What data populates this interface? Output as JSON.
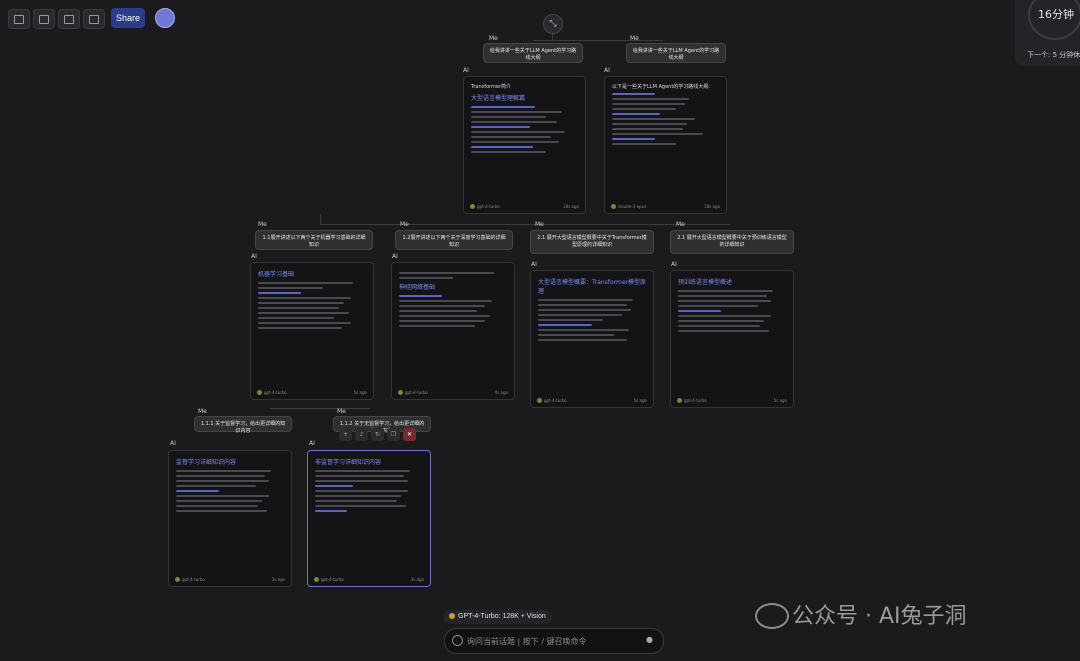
{
  "toolbar": {
    "share_label": "Share"
  },
  "timer": {
    "value": "16分钟",
    "next_label": "下一个: 5 分钟休息"
  },
  "labels": {
    "me": "Me",
    "ai": "AI"
  },
  "nodes": {
    "root_left": {
      "prompt": "给我讲讲一些关于LLM Agent的学习路线大纲",
      "title": "Transformer简介",
      "heading": "大型语言模型理解篇",
      "model": "gpt-4-turbo",
      "time": "18s ago"
    },
    "root_right": {
      "prompt": "给我讲讲一些关于LLM Agent的学习路线大纲",
      "title": "以下是一些关于LLM Agent的学习路线大纲:",
      "model": "claude-3-opus",
      "time": "18s ago"
    },
    "n1": {
      "prompt": "1.1展开讲述以下两个关于机器学习基础的详细知识",
      "heading": "机器学习基础",
      "model": "gpt-4-turbo",
      "time": "5s ago"
    },
    "n2": {
      "prompt": "1.2展开讲述以下两个关于深度学习基础的详细知识",
      "heading": "神经网络基础",
      "model": "gpt-4-turbo",
      "time": "4s ago"
    },
    "n3": {
      "prompt": "2.1 展开大型语言模型概要中关于Transformer模型原理的详细知识",
      "heading": "大型语言模型概要：Transformer模型原理",
      "model": "gpt-4-turbo",
      "time": "5s ago"
    },
    "n4": {
      "prompt": "2.1 展开大型语言模型概要中关于预训练语言模型的详细知识",
      "heading": "预训练语言模型概述",
      "model": "gpt-4-turbo",
      "time": "5s ago"
    },
    "n5": {
      "prompt": "1.1.1 关于监督学习，给出更详细的知识内容",
      "heading": "监督学习详细知识内容",
      "model": "gpt-4-turbo",
      "time": "3s ago"
    },
    "n6": {
      "prompt": "1.1.2 关于无监督学习，给出更详细的知识内容",
      "heading": "非监督学习详细知识内容",
      "model": "gpt-4-turbo",
      "time": "3s ago"
    }
  },
  "footer": {
    "model_pill": "GPT-4-Turbo: 128K + Vision",
    "input_placeholder": "询问当前话题 | 按下 / 键召唤命令"
  },
  "watermark": "公众号 · AI兔子洞"
}
